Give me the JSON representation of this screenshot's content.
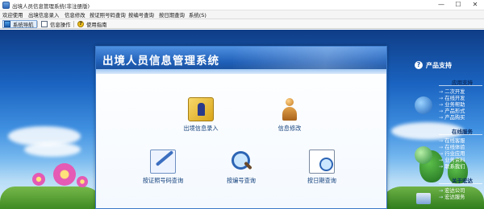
{
  "window": {
    "title": "出境人员信息管理系统(非注册版)",
    "controls": {
      "minimize": "—",
      "maximize": "☐",
      "close": "✕"
    }
  },
  "menubar": {
    "items": [
      {
        "label": "欢迎使用"
      },
      {
        "label": "出境信息录入"
      },
      {
        "label": "信息修改"
      },
      {
        "label": "按证照号码查询"
      },
      {
        "label": "按编号查询"
      },
      {
        "label": "按日期查询"
      },
      {
        "label": "系统(S)"
      }
    ]
  },
  "toolbar": {
    "items": [
      {
        "label": "系统导航",
        "icon": "tree-icon",
        "active": true
      },
      {
        "label": "信息操作",
        "icon": "document-icon",
        "active": false
      },
      {
        "label": "使用指南",
        "icon": "help-icon",
        "active": false
      }
    ]
  },
  "panel": {
    "title": "出境人员信息管理系统",
    "features": [
      {
        "label": "出境信息录入",
        "icon": "folder-person-icon"
      },
      {
        "label": "信息修改",
        "icon": "person-icon"
      },
      {
        "label": "按证照号码查询",
        "icon": "pen-document-icon"
      },
      {
        "label": "按编号查询",
        "icon": "magnifier-icon"
      },
      {
        "label": "按日期查询",
        "icon": "document-search-icon"
      }
    ]
  },
  "sidebar": {
    "heading": "产品支持",
    "heading_icon": "?",
    "sections": [
      {
        "title": "应用支持",
        "links": [
          "二次开发",
          "在线开发",
          "业务帮助",
          "产品形式",
          "产品购买"
        ]
      },
      {
        "title": "在线服务",
        "links": [
          "在线客服",
          "在线体验",
          "行业应用",
          "业务资料",
          "联系我们"
        ]
      },
      {
        "title": "关于宏达",
        "links": [
          "宏达公司",
          "宏达服务"
        ]
      }
    ]
  },
  "colors": {
    "panel_header": "#1f5fb8",
    "desktop_sky": "#1a63c0",
    "feature_label": "#16437e"
  }
}
